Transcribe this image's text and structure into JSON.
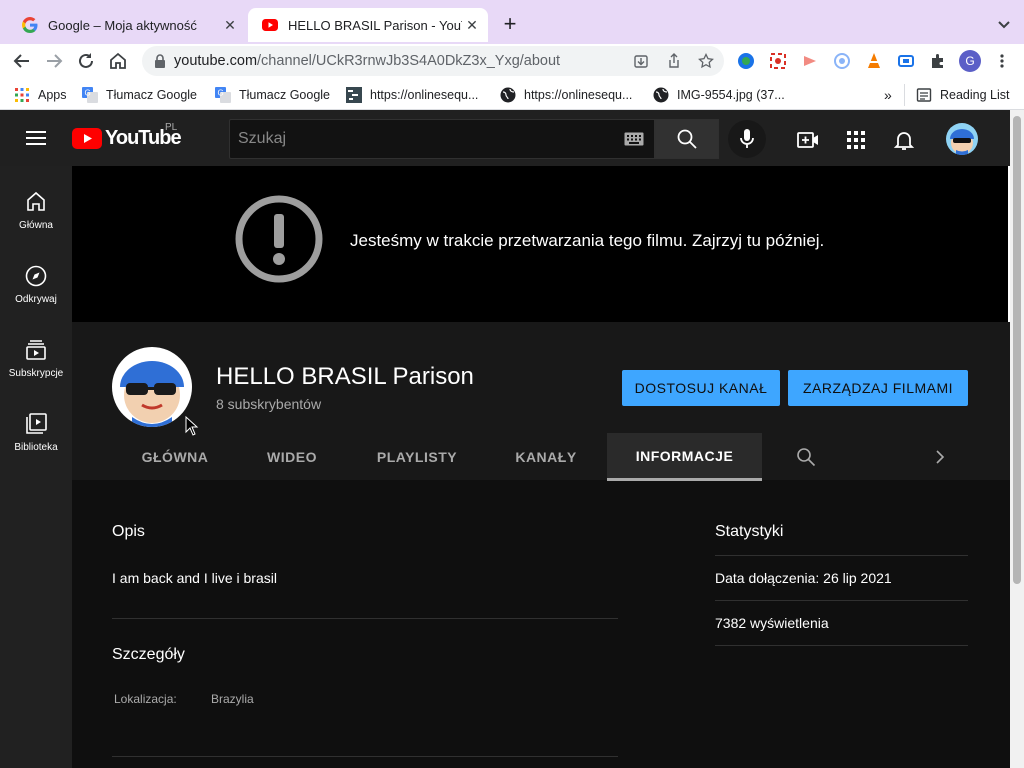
{
  "browser": {
    "tabs": [
      {
        "title": "Google – Moja aktywność",
        "favicon": "google-icon"
      },
      {
        "title": "HELLO BRASIL Parison - YouTube",
        "favicon": "youtube-icon"
      }
    ],
    "url_host": "youtube.com",
    "url_path": "/channel/UCkR3rnwJb3S4A0DkZ3x_Yxg/about",
    "bookmarks": [
      {
        "label": "Apps",
        "icon": "apps-grid-icon"
      },
      {
        "label": "Tłumacz Google",
        "icon": "translate-icon"
      },
      {
        "label": "Tłumacz Google",
        "icon": "translate-icon"
      },
      {
        "label": "https://onlinesequ...",
        "icon": "sequencer-icon"
      },
      {
        "label": "https://onlinesequ...",
        "icon": "globe-icon"
      },
      {
        "label": "IMG-9554.jpg (37...",
        "icon": "globe-icon"
      }
    ],
    "overflow": "»",
    "reading_list": "Reading List",
    "profile_initial": "G"
  },
  "youtube": {
    "logo_text": "YouTube",
    "country_code": "PL",
    "search_placeholder": "Szukaj",
    "sidebar": [
      {
        "label": "Główna",
        "icon": "home-icon"
      },
      {
        "label": "Odkrywaj",
        "icon": "compass-icon"
      },
      {
        "label": "Subskrypcje",
        "icon": "subscriptions-icon"
      },
      {
        "label": "Biblioteka",
        "icon": "library-icon"
      }
    ],
    "banner_message": "Jesteśmy w trakcie przetwarzania tego filmu. Zajrzyj tu później.",
    "channel": {
      "name": "HELLO BRASIL Parison",
      "subscribers": "8 subskrybentów",
      "customize_button": "DOSTOSUJ KANAŁ",
      "manage_button": "ZARZĄDZAJ FILMAMI"
    },
    "tabs": [
      "GŁÓWNA",
      "WIDEO",
      "PLAYLISTY",
      "KANAŁY",
      "INFORMACJE"
    ],
    "active_tab": "INFORMACJE",
    "about": {
      "description_title": "Opis",
      "description": "I am back and I live i brasil",
      "details_title": "Szczegóły",
      "location_label": "Lokalizacja:",
      "location_value": "Brazylia",
      "stats_title": "Statystyki",
      "joined": "Data dołączenia: 26 lip 2021",
      "views": "7382 wyświetlenia"
    }
  },
  "colors": {
    "accent_blue": "#3ea6ff",
    "youtube_red": "#ff0000",
    "tab_strip": "#e8d9f7"
  }
}
